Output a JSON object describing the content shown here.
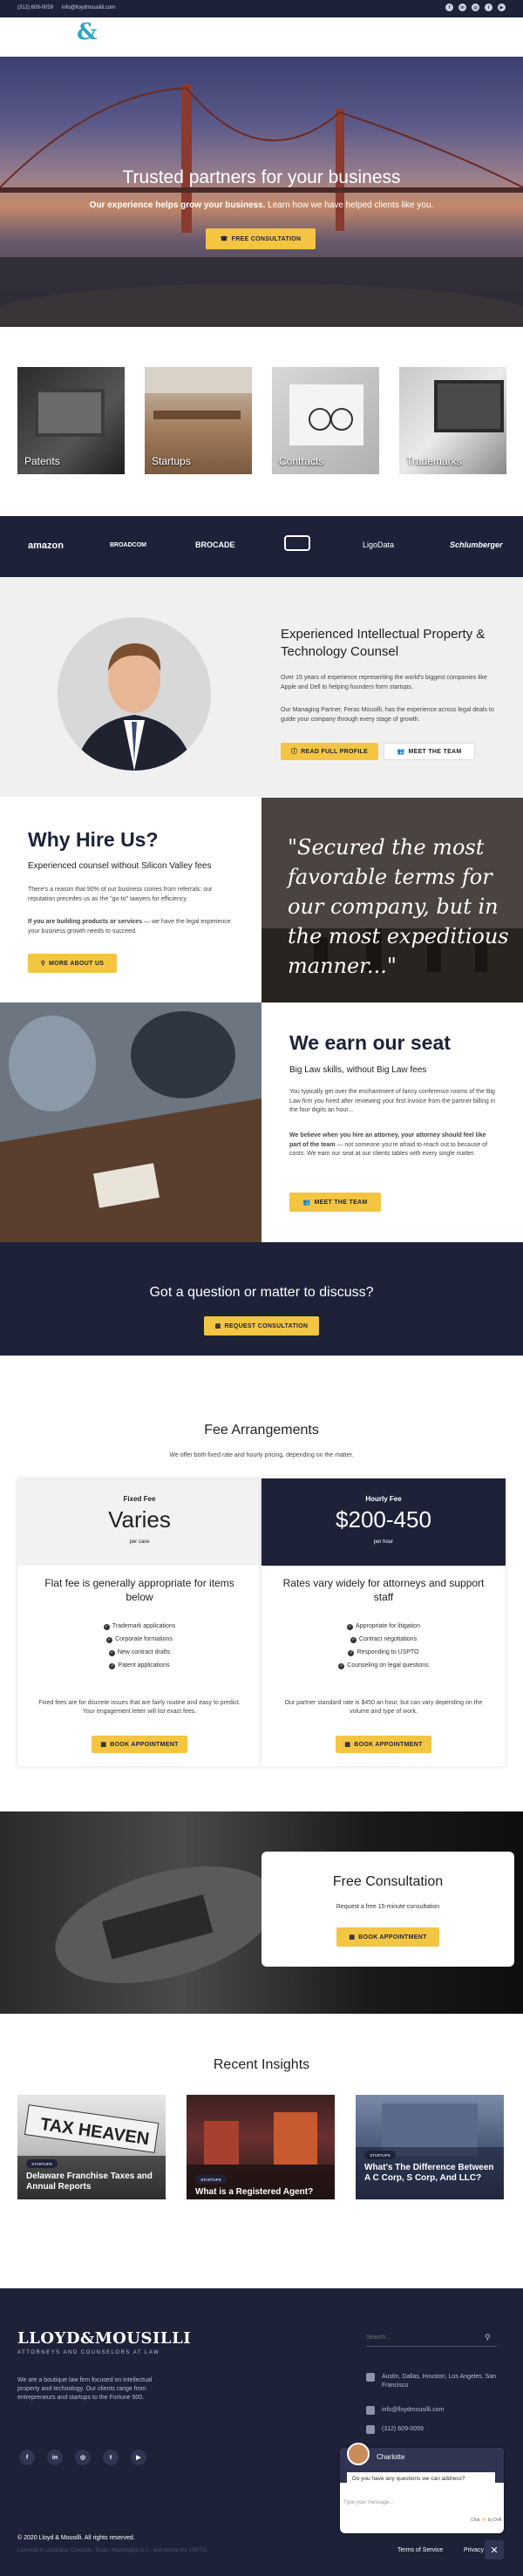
{
  "colors": {
    "navy": "#1d2239",
    "accent": "#f4c542",
    "logo_teal": "#2fa4c9"
  },
  "topbar": {
    "phone": "(312) 609-0059",
    "email": "info@lloydmousilli.com",
    "social_icons": [
      "facebook-icon",
      "linkedin-icon",
      "instagram-icon",
      "twitter-icon",
      "youtube-icon"
    ]
  },
  "brand": {
    "mark": "&"
  },
  "hero": {
    "title": "Trusted partners for your business",
    "subtitle_bold": "Our experience helps grow your business.",
    "subtitle_rest": " Learn how we have helped clients like you.",
    "button": "FREE CONSULTATION"
  },
  "practice": [
    {
      "label": "Patents"
    },
    {
      "label": "Startups"
    },
    {
      "label": "Contracts"
    },
    {
      "label": "Trademarks"
    }
  ],
  "logos": [
    "amazon",
    "BROADCOM",
    "BROCADE",
    "",
    "LigoData",
    "Schlumberger"
  ],
  "counsel": {
    "title": "Experienced Intellectual Property & Technology Counsel",
    "p1": "Over 15 years of experience representing the world's biggest companies like Apple and Dell to helping founders form startups.",
    "p2": "Our Managing Partner, Feras Mousilli, has the experience across legal deals to guide your company through every stage of growth.",
    "read_btn": "READ FULL PROFILE",
    "meet_btn": "MEET THE TEAM"
  },
  "why": {
    "title": "Why Hire Us?",
    "subtitle": "Experienced counsel without Silicon Valley fees",
    "p1": "There's a reason that 90% of our business comes from referrals: our reputation precedes us as the \"go-to\" lawyers for efficiency.",
    "p2_bold": "If you are building products or services",
    "p2_rest": " — we have the legal experience your business growth needs to succeed.",
    "button": "MORE ABOUT US",
    "quote": "\"Secured the most favorable terms for our company, but in the most expeditious manner...\""
  },
  "earn": {
    "title": "We earn our seat",
    "subtitle": "Big Law skills, without Big Law fees",
    "p1": "You typically get over the enchantment of fancy conference rooms of the Big Law firm you hired after reviewing your first invoice from the partner billing in the four digits an hour...",
    "p2_bold": "We believe when you hire an attorney, your attorney should feel like part of the team",
    "p2_rest": " — not someone you're afraid to reach out to because of costs. We earn our seat at our clients tables with every single matter.",
    "button": "MEET THE TEAM"
  },
  "question": {
    "title": "Got a question or matter to discuss?",
    "button": "REQUEST CONSULTATION"
  },
  "fees": {
    "title": "Fee Arrangements",
    "subtitle": "We offer both fixed rate and hourly pricing, depending on the matter.",
    "cards": [
      {
        "name": "Fixed Fee",
        "price": "Varies",
        "unit": "per case",
        "heading": "Flat fee is generally appropriate for items below",
        "items": [
          "Trademark applications",
          "Corporate formations",
          "New contract drafts",
          "Patent applications"
        ],
        "desc": "Fixed fees are for discrete issues that are fairly routine and easy to predict. Your engagement letter will list exact fees.",
        "button": "BOOK APPOINTMENT"
      },
      {
        "name": "Hourly Fee",
        "price": "$200-450",
        "unit": "per hour",
        "heading": "Rates vary widely for attorneys and support staff",
        "items": [
          "Appropriate for litigation",
          "Contract negotiations",
          "Responding to USPTO",
          "Counseling on legal questions"
        ],
        "desc": "Our partner standard rate is $450 an hour, but can vary depending on the volume and type of work.",
        "button": "BOOK APPOINTMENT"
      }
    ]
  },
  "consult": {
    "title": "Free Consultation",
    "subtitle": "Request a free 15-minute consultation",
    "button": "BOOK APPOINTMENT"
  },
  "insights": {
    "title": "Recent Insights",
    "posts": [
      {
        "tag": "STARTUPS",
        "title": "Delaware Franchise Taxes and Annual Reports"
      },
      {
        "tag": "STARTUPS",
        "title": "What is a Registered Agent?"
      },
      {
        "tag": "STARTUPS",
        "title": "What's The Difference Between A C Corp, S Corp, And LLC?"
      }
    ]
  },
  "footer": {
    "logo": "LLOYD&MOUSILLI",
    "tagline": "ATTORNEYS AND COUNSELORS AT LAW",
    "desc": "We are a boutique law firm focused on intellectual property and technology. Our clients range from entrepreneurs and startups to the Fortune 500.",
    "search_placeholder": "Search...",
    "address": "Austin, Dallas, Houston, Los Angeles, San Francisco",
    "email": "info@lloydmousilli.com",
    "phone": "(312) 609-0059",
    "copyright": "© 2020 Lloyd & Mousilli. All rights reserved.",
    "powered": "Licensed in Louisiana, Colorado, Texas, Washington D.C., and before the USPTO",
    "terms": "Terms of Service",
    "privacy": "Privacy"
  },
  "chat": {
    "name": "Charlotte",
    "message": "Do you have any questions we can address?",
    "input_placeholder": "Type your message...",
    "powered": "Chat ⚡ by Drift",
    "close": "✕"
  }
}
